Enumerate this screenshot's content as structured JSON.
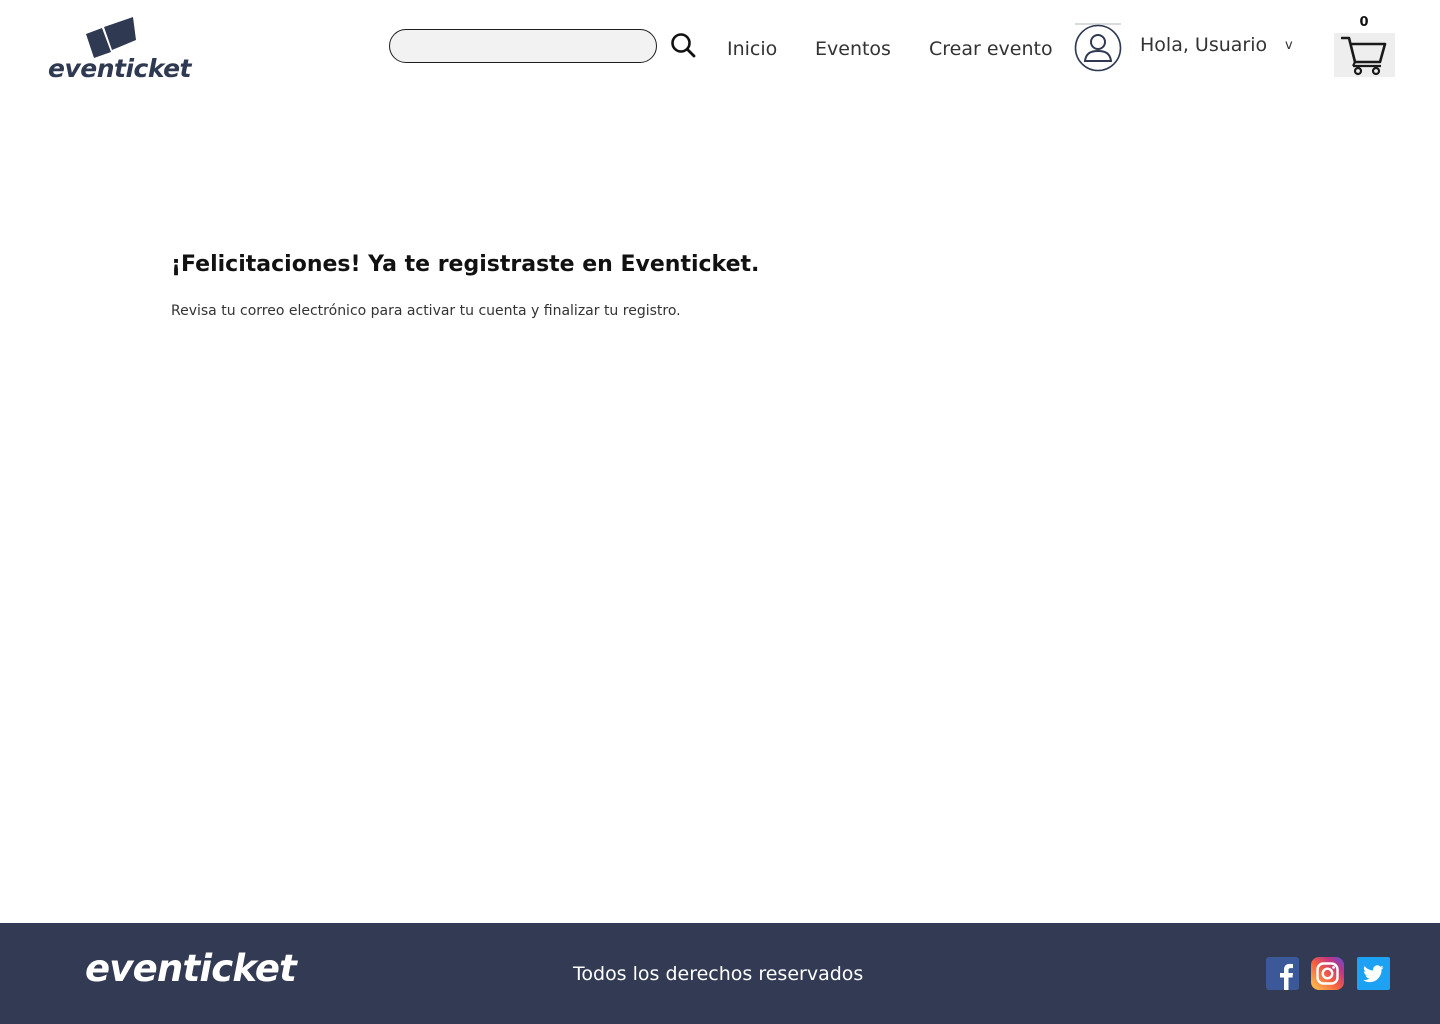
{
  "header": {
    "logo_text": "eventicket",
    "search": {
      "value": "",
      "placeholder": ""
    },
    "nav": [
      {
        "label": "Inicio"
      },
      {
        "label": "Eventos"
      },
      {
        "label": "Crear evento"
      }
    ],
    "user": {
      "greeting": "Hola, Usuario",
      "dropdown_glyph": "v"
    },
    "cart": {
      "count": "0"
    }
  },
  "main": {
    "title": "¡Felicitaciones! Ya te registraste en Eventicket.",
    "message": "Revisa tu correo electrónico para activar tu cuenta y finalizar tu registro."
  },
  "footer": {
    "logo_text": "eventicket",
    "copyright": "Todos los derechos reservados",
    "social": [
      {
        "icon": "facebook-icon"
      },
      {
        "icon": "instagram-icon"
      },
      {
        "icon": "twitter-icon"
      }
    ]
  },
  "colors": {
    "brand_navy": "#323b53",
    "facebook": "#3b5998",
    "twitter": "#1da1f2"
  }
}
